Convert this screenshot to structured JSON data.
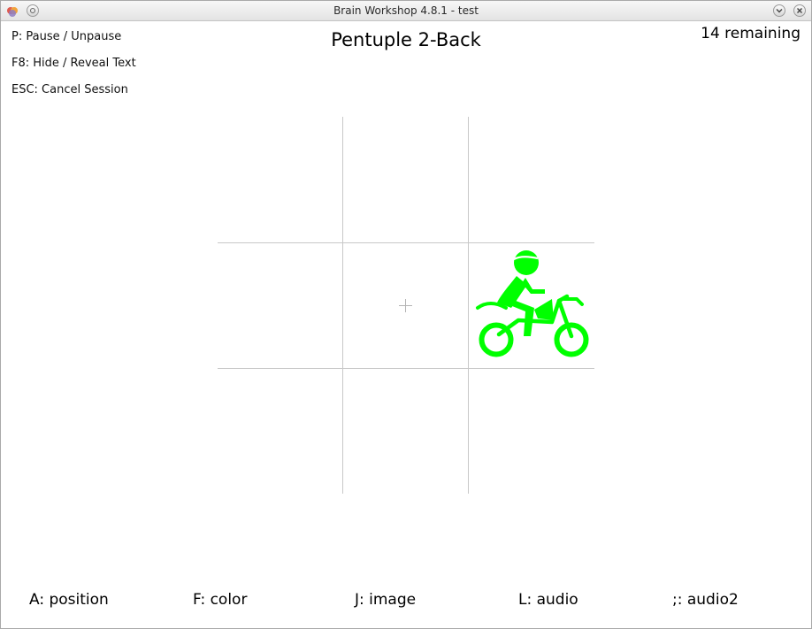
{
  "window": {
    "title": "Brain Workshop 4.8.1 - test"
  },
  "hints": {
    "pause": "P: Pause / Unpause",
    "hide": "F8: Hide / Reveal Text",
    "cancel": "ESC: Cancel Session"
  },
  "session": {
    "mode_title": "Pentuple 2-Back",
    "remaining": "14 remaining"
  },
  "stimulus": {
    "icon": "motorcycle-rider-icon",
    "color": "#00ff00",
    "grid_cell": "middle-right"
  },
  "grid": {
    "line_color": "#c8c8c8"
  },
  "keys": [
    {
      "label": "A: position"
    },
    {
      "label": "F: color"
    },
    {
      "label": "J: image"
    },
    {
      "label": "L: audio"
    },
    {
      "label": ";: audio2"
    }
  ]
}
